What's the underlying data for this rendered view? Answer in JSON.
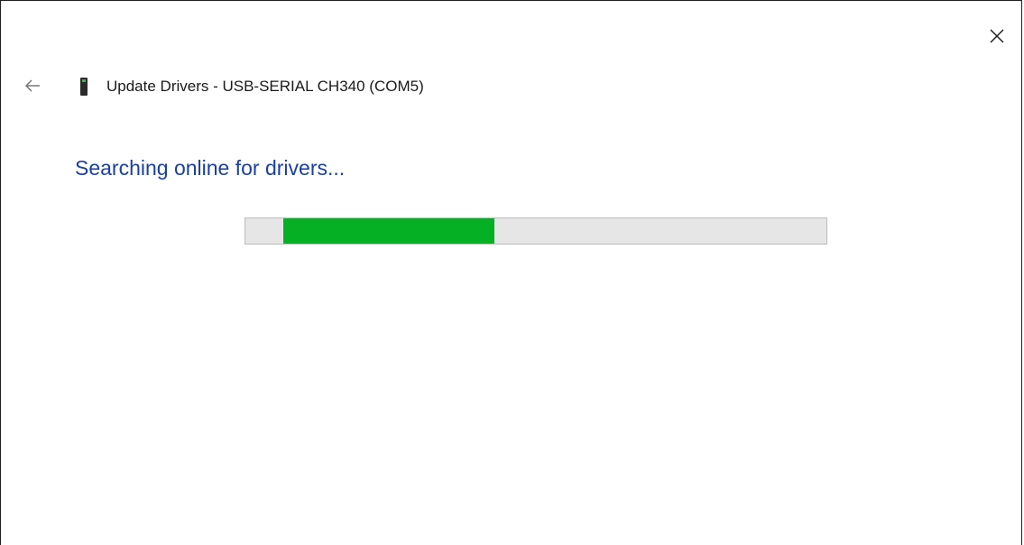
{
  "window": {
    "title": "Update Drivers - USB-SERIAL CH340 (COM5)",
    "close_icon": "close-icon",
    "back_icon": "back-arrow-icon",
    "device_icon": "usb-device-icon"
  },
  "main": {
    "status_text": "Searching online for drivers..."
  },
  "progress": {
    "mode": "indeterminate",
    "segment_start_fraction": 0.065,
    "segment_end_fraction": 0.428
  },
  "colors": {
    "heading": "#1c3fa0",
    "progress_fill": "#06b025",
    "progress_track": "#e6e6e6"
  }
}
